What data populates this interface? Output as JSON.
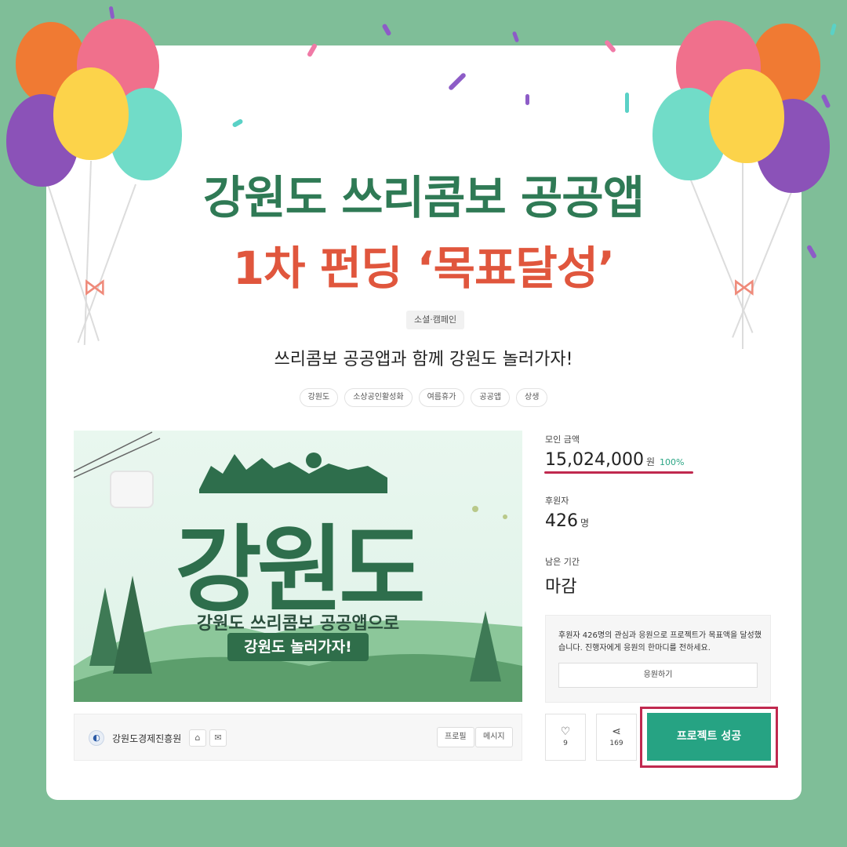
{
  "headline": {
    "line1": "강원도 쓰리콤보 공공앱",
    "line2": "1차 펀딩 ‘목표달성’"
  },
  "category_chip": "소셜·캠페인",
  "project_title": "쓰리콤보 공공앱과 함께 강원도 놀러가자!",
  "tags": [
    "강원도",
    "소상공인활성화",
    "여름휴가",
    "공공앱",
    "상생"
  ],
  "hero": {
    "big_title": "강원도",
    "line1": "강원도 쓰리콤보 공공앱으로",
    "pill": "강원도 놀러가자!"
  },
  "creator": {
    "name": "강원도경제진흥원",
    "profile_label": "프로필",
    "message_label": "메시지"
  },
  "stats": {
    "raised_label": "모인 금액",
    "raised_value": "15,024,000",
    "raised_unit": "원",
    "raised_pct": "100%",
    "backers_label": "후원자",
    "backers_value": "426",
    "backers_unit": "명",
    "remaining_label": "남은 기간",
    "remaining_value": "마감"
  },
  "notice": {
    "text": "후원자 426명의 관심과 응원으로 프로젝트가 목표액을 달성했습니다. 진행자에게 응원의 한마디를 전하세요.",
    "button": "응원하기"
  },
  "actions": {
    "like_count": "9",
    "share_count": "169",
    "success_button": "프로젝트 성공"
  },
  "colors": {
    "background": "#7fbe98",
    "headline_green": "#2f7a55",
    "headline_red": "#e0563d",
    "accent_teal": "#26a383",
    "highlight_red": "#c0294f"
  }
}
